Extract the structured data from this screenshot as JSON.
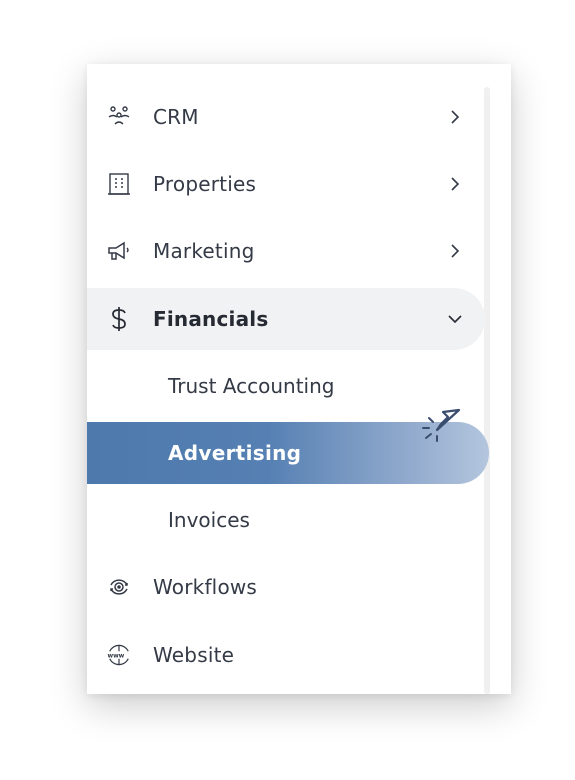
{
  "menu": {
    "items": [
      {
        "label": "CRM",
        "icon": "people-group-icon",
        "chevron": "right"
      },
      {
        "label": "Properties",
        "icon": "building-icon",
        "chevron": "right"
      },
      {
        "label": "Marketing",
        "icon": "megaphone-icon",
        "chevron": "right"
      },
      {
        "label": "Financials",
        "icon": "dollar-icon",
        "chevron": "down",
        "expanded": true
      },
      {
        "label": "Workflows",
        "icon": "workflow-icon"
      },
      {
        "label": "Website",
        "icon": "www-globe-icon"
      }
    ],
    "financials_sub": [
      {
        "label": "Trust Accounting"
      },
      {
        "label": "Advertising",
        "selected": true
      },
      {
        "label": "Invoices"
      }
    ]
  },
  "colors": {
    "text": "#343a46",
    "selected_start": "#4d79ad",
    "selected_end": "#b4c6de",
    "expanded_bg": "#f1f2f3"
  }
}
